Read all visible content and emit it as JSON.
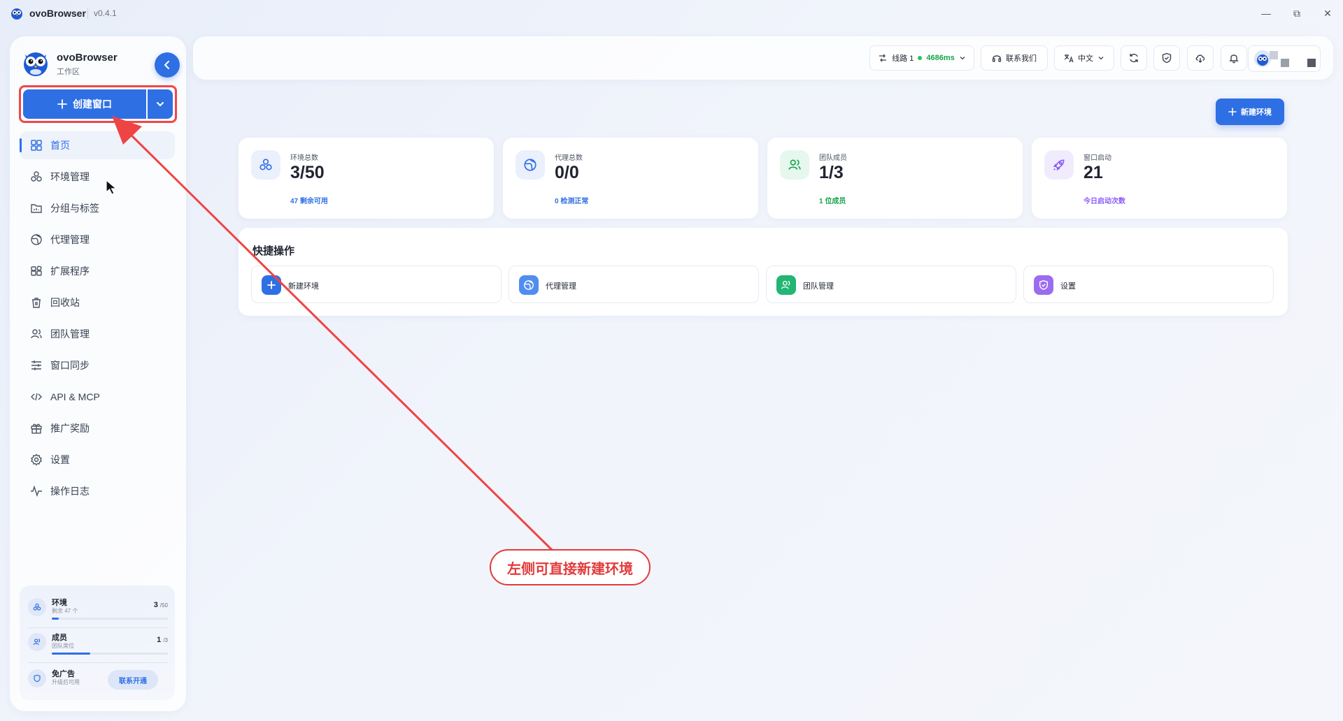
{
  "app": {
    "name": "ovoBrowser",
    "version": "v0.4.1"
  },
  "window_controls": {
    "minimize": "—",
    "restore": "⧉",
    "close": "✕"
  },
  "sidebar": {
    "brand_name": "ovoBrowser",
    "brand_sub": "工作区",
    "create_button": "创建窗口",
    "items": [
      {
        "label": "首页",
        "icon": "dashboard-icon"
      },
      {
        "label": "环境管理",
        "icon": "cubes-icon"
      },
      {
        "label": "分组与标签",
        "icon": "folder-tag-icon"
      },
      {
        "label": "代理管理",
        "icon": "globe-icon"
      },
      {
        "label": "扩展程序",
        "icon": "extension-icon"
      },
      {
        "label": "回收站",
        "icon": "trash-icon"
      },
      {
        "label": "团队管理",
        "icon": "users-icon"
      },
      {
        "label": "窗口同步",
        "icon": "sliders-icon"
      },
      {
        "label": "API & MCP",
        "icon": "code-icon"
      },
      {
        "label": "推广奖励",
        "icon": "gift-icon"
      },
      {
        "label": "设置",
        "icon": "gear-icon"
      },
      {
        "label": "操作日志",
        "icon": "activity-icon"
      }
    ],
    "usage": {
      "env": {
        "title": "环境",
        "sub": "剩余 47 个",
        "count": "3",
        "limit": "/50",
        "fraction": 0.06
      },
      "members": {
        "title": "成员",
        "sub": "团队席位",
        "count": "1",
        "limit": "/3",
        "fraction": 0.33
      },
      "noads": {
        "title": "免广告",
        "sub": "升级后可用",
        "button": "联系开通"
      }
    }
  },
  "topbar": {
    "line_label": "线路 1",
    "latency": "4686ms",
    "contact": "联系我们",
    "language": "中文"
  },
  "main": {
    "new_env_button": "新建环境",
    "stats": [
      {
        "label": "环境总数",
        "value": "3/50",
        "sub": "47 剩余可用",
        "color": "#2f6fe4"
      },
      {
        "label": "代理总数",
        "value": "0/0",
        "sub": "0 检测正常",
        "color": "#2f6fe4"
      },
      {
        "label": "团队成员",
        "value": "1/3",
        "sub": "1 位成员",
        "color": "#16a34a"
      },
      {
        "label": "窗口启动",
        "value": "21",
        "sub": "今日启动次数",
        "color": "#8b5cf6"
      }
    ],
    "quick": {
      "title": "快捷操作",
      "actions": [
        {
          "label": "新建环境",
          "icon": "plus-icon"
        },
        {
          "label": "代理管理",
          "icon": "globe-icon"
        },
        {
          "label": "团队管理",
          "icon": "users-icon"
        },
        {
          "label": "设置",
          "icon": "shield-icon"
        }
      ]
    }
  },
  "annotation": {
    "text": "左侧可直接新建环境",
    "color": "#e23b3b"
  }
}
